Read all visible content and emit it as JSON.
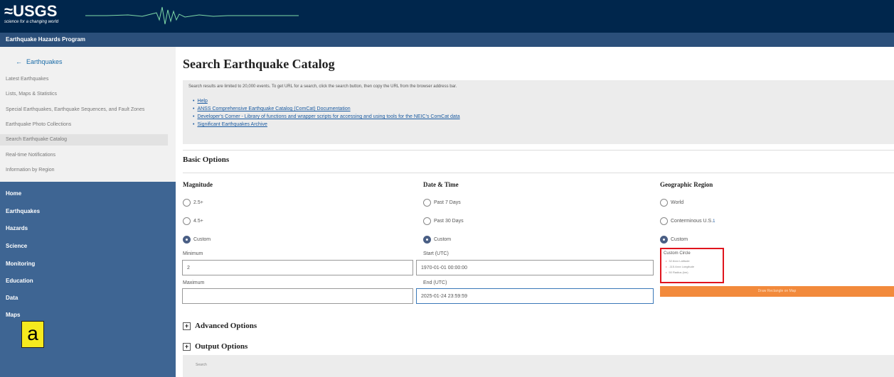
{
  "header": {
    "logo_text": "≈USGS",
    "tagline": "science for a changing world",
    "program": "Earthquake Hazards Program"
  },
  "sidebar": {
    "back_arrow": "←",
    "back_label": "Earthquakes",
    "links": [
      "Latest Earthquakes",
      "Lists, Maps & Statistics",
      "Special Earthquakes, Earthquake Sequences, and Fault Zones",
      "Earthquake Photo Collections",
      "Search Earthquake Catalog",
      "Real-time Notifications",
      "Information by Region"
    ],
    "nav": [
      "Home",
      "Earthquakes",
      "Hazards",
      "Science",
      "Monitoring",
      "Education",
      "Data",
      "Maps"
    ]
  },
  "overlay_label": "a",
  "main": {
    "title": "Search Earthquake Catalog",
    "note": "Search results are limited to 20,000 events. To get URL for a search, click the search button, then copy the URL from the browser address bar.",
    "links": [
      "Help",
      "ANSS Comprehensive Earthquake Catalog (ComCat) Documentation",
      "Developer's Corner - Library of functions and wrapper scripts for accessing and using tools for the NEIC's ComCat data",
      "Significant Earthquakes Archive"
    ],
    "basic_options": "Basic Options",
    "magnitude": {
      "heading": "Magnitude",
      "options": [
        "2.5+",
        "4.5+",
        "Custom"
      ],
      "min_label": "Minimum",
      "min_value": "2",
      "max_label": "Maximum",
      "max_value": ""
    },
    "datetime": {
      "heading": "Date & Time",
      "options": [
        "Past 7 Days",
        "Past 30 Days",
        "Custom"
      ],
      "start_label": "Start (UTC)",
      "start_value": "1970-01-01 00:00:00",
      "end_label": "End (UTC)",
      "end_value": "2025-01-24 23:59:59"
    },
    "region": {
      "heading": "Geographic Region",
      "options": [
        "World",
        "Conterminous U.S.",
        "Custom"
      ],
      "footnote": "1",
      "circle_title": "Custom Circle",
      "circle_items": [
        "32.6xxx Latitude",
        "-115.4xxx Longitude",
        "50 Radius (km)"
      ],
      "draw_button": "Draw Rectangle on Map"
    },
    "advanced": "Advanced Options",
    "output": "Output Options",
    "search_button": "Search"
  },
  "colors": {
    "header_bg": "#00264c",
    "nav_bg": "#3e6593",
    "accent": "#f28a3c",
    "highlight": "#e0141d"
  }
}
